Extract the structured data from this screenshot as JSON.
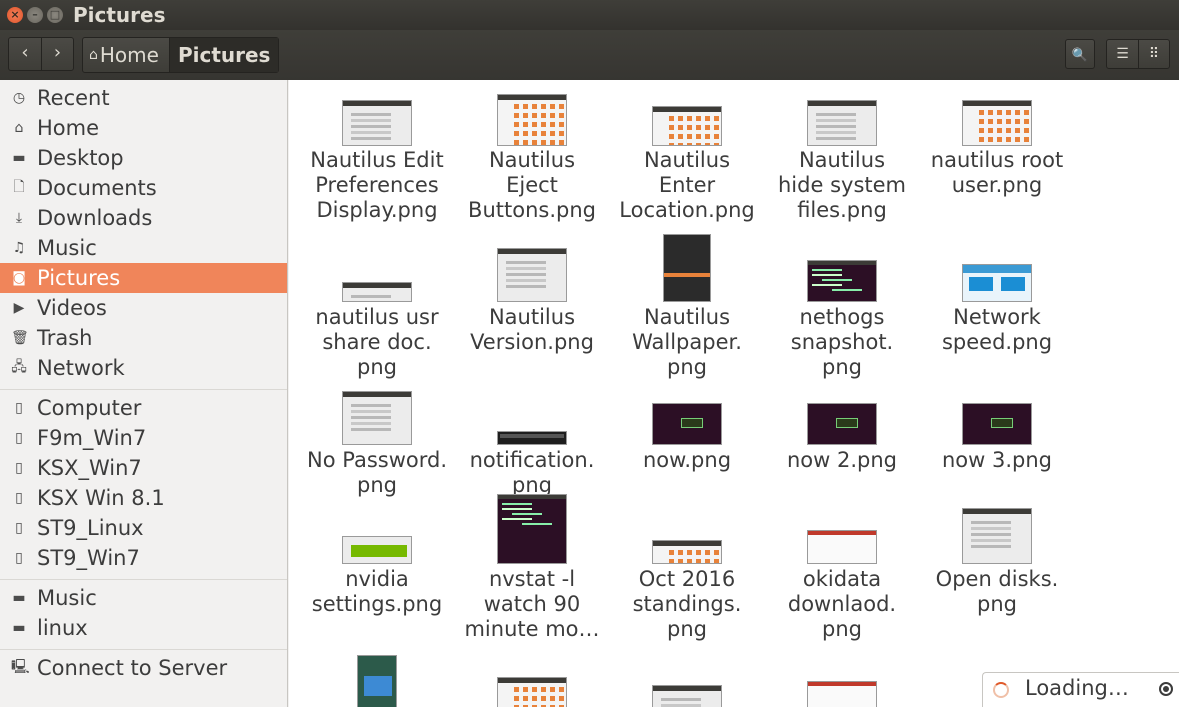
{
  "window": {
    "title": "Pictures",
    "close_glyph": "×",
    "minimize_glyph": "–",
    "maximize_glyph": "□"
  },
  "toolbar": {
    "back_glyph": "‹",
    "forward_glyph": "›",
    "breadcrumbs": [
      "Home",
      "Pictures"
    ],
    "home_glyph": "⌂",
    "search_glyph": "🔍",
    "list_view_glyph": "☰",
    "grid_view_glyph": "⠿"
  },
  "sidebar": {
    "places": [
      {
        "label": "Recent",
        "icon": "clock-icon",
        "glyph": "◷"
      },
      {
        "label": "Home",
        "icon": "home-icon",
        "glyph": "⌂"
      },
      {
        "label": "Desktop",
        "icon": "folder-icon",
        "glyph": "▬"
      },
      {
        "label": "Documents",
        "icon": "document-icon",
        "glyph": "🗋"
      },
      {
        "label": "Downloads",
        "icon": "download-icon",
        "glyph": "⤓"
      },
      {
        "label": "Music",
        "icon": "music-icon",
        "glyph": "♫"
      },
      {
        "label": "Pictures",
        "icon": "camera-icon",
        "glyph": "◙"
      },
      {
        "label": "Videos",
        "icon": "video-icon",
        "glyph": "▶"
      },
      {
        "label": "Trash",
        "icon": "trash-icon",
        "glyph": "🗑"
      },
      {
        "label": "Network",
        "icon": "network-icon",
        "glyph": "🖧"
      }
    ],
    "devices": [
      {
        "label": "Computer",
        "icon": "drive-icon",
        "glyph": "▯"
      },
      {
        "label": "F9m_Win7",
        "icon": "drive-icon",
        "glyph": "▯"
      },
      {
        "label": "KSX_Win7",
        "icon": "drive-icon",
        "glyph": "▯"
      },
      {
        "label": "KSX Win 8.1",
        "icon": "drive-icon",
        "glyph": "▯"
      },
      {
        "label": "ST9_Linux",
        "icon": "drive-icon",
        "glyph": "▯"
      },
      {
        "label": "ST9_Win7",
        "icon": "drive-icon",
        "glyph": "▯"
      }
    ],
    "bookmarks": [
      {
        "label": "Music",
        "icon": "folder-icon",
        "glyph": "▬"
      },
      {
        "label": "linux",
        "icon": "folder-icon",
        "glyph": "▬"
      }
    ],
    "connect": {
      "label": "Connect to Server",
      "icon": "server-icon",
      "glyph": "🖳"
    },
    "active_index": 6
  },
  "files": [
    {
      "name": "Nautilus Edit Preferences Display.png",
      "lines": [
        "Nautilus Edit",
        "Preferences",
        "Display.png"
      ]
    },
    {
      "name": "Nautilus Eject Buttons.png",
      "lines": [
        "Nautilus",
        "Eject",
        "Buttons.png"
      ]
    },
    {
      "name": "Nautilus Enter Location.png",
      "lines": [
        "Nautilus",
        "Enter",
        "Location.png"
      ]
    },
    {
      "name": "Nautilus hide system files.png",
      "lines": [
        "Nautilus",
        "hide system",
        "files.png"
      ]
    },
    {
      "name": "nautilus root user.png",
      "lines": [
        "nautilus root",
        "user.png"
      ]
    },
    {
      "name": "nautilus usr share doc.png",
      "lines": [
        "nautilus usr",
        "share doc.",
        "png"
      ]
    },
    {
      "name": "Nautilus Version.png",
      "lines": [
        "Nautilus",
        "Version.png"
      ]
    },
    {
      "name": "Nautilus Wallpaper.png",
      "lines": [
        "Nautilus",
        "Wallpaper.",
        "png"
      ]
    },
    {
      "name": "nethogs snapshot.png",
      "lines": [
        "nethogs",
        "snapshot.",
        "png"
      ]
    },
    {
      "name": "Network speed.png",
      "lines": [
        "Network",
        "speed.png"
      ]
    },
    {
      "name": "No Password.png",
      "lines": [
        "No Password.",
        "png"
      ]
    },
    {
      "name": "notification.png",
      "lines": [
        "notification.",
        "png"
      ]
    },
    {
      "name": "now.png",
      "lines": [
        "now.png"
      ]
    },
    {
      "name": "now 2.png",
      "lines": [
        "now 2.png"
      ]
    },
    {
      "name": "now 3.png",
      "lines": [
        "now 3.png"
      ]
    },
    {
      "name": "nvidia settings.png",
      "lines": [
        "nvidia",
        "settings.png"
      ]
    },
    {
      "name": "nvstat -l watch 90 minute mo…",
      "lines": [
        "nvstat -l",
        "watch 90",
        "minute mo…"
      ]
    },
    {
      "name": "Oct 2016 standings.png",
      "lines": [
        "Oct 2016",
        "standings.",
        "png"
      ]
    },
    {
      "name": "okidata downlaod.png",
      "lines": [
        "okidata",
        "downlaod.",
        "png"
      ]
    },
    {
      "name": "Open disks.png",
      "lines": [
        "Open disks.",
        "png"
      ]
    }
  ],
  "status": {
    "loading_text": "Loading…"
  }
}
